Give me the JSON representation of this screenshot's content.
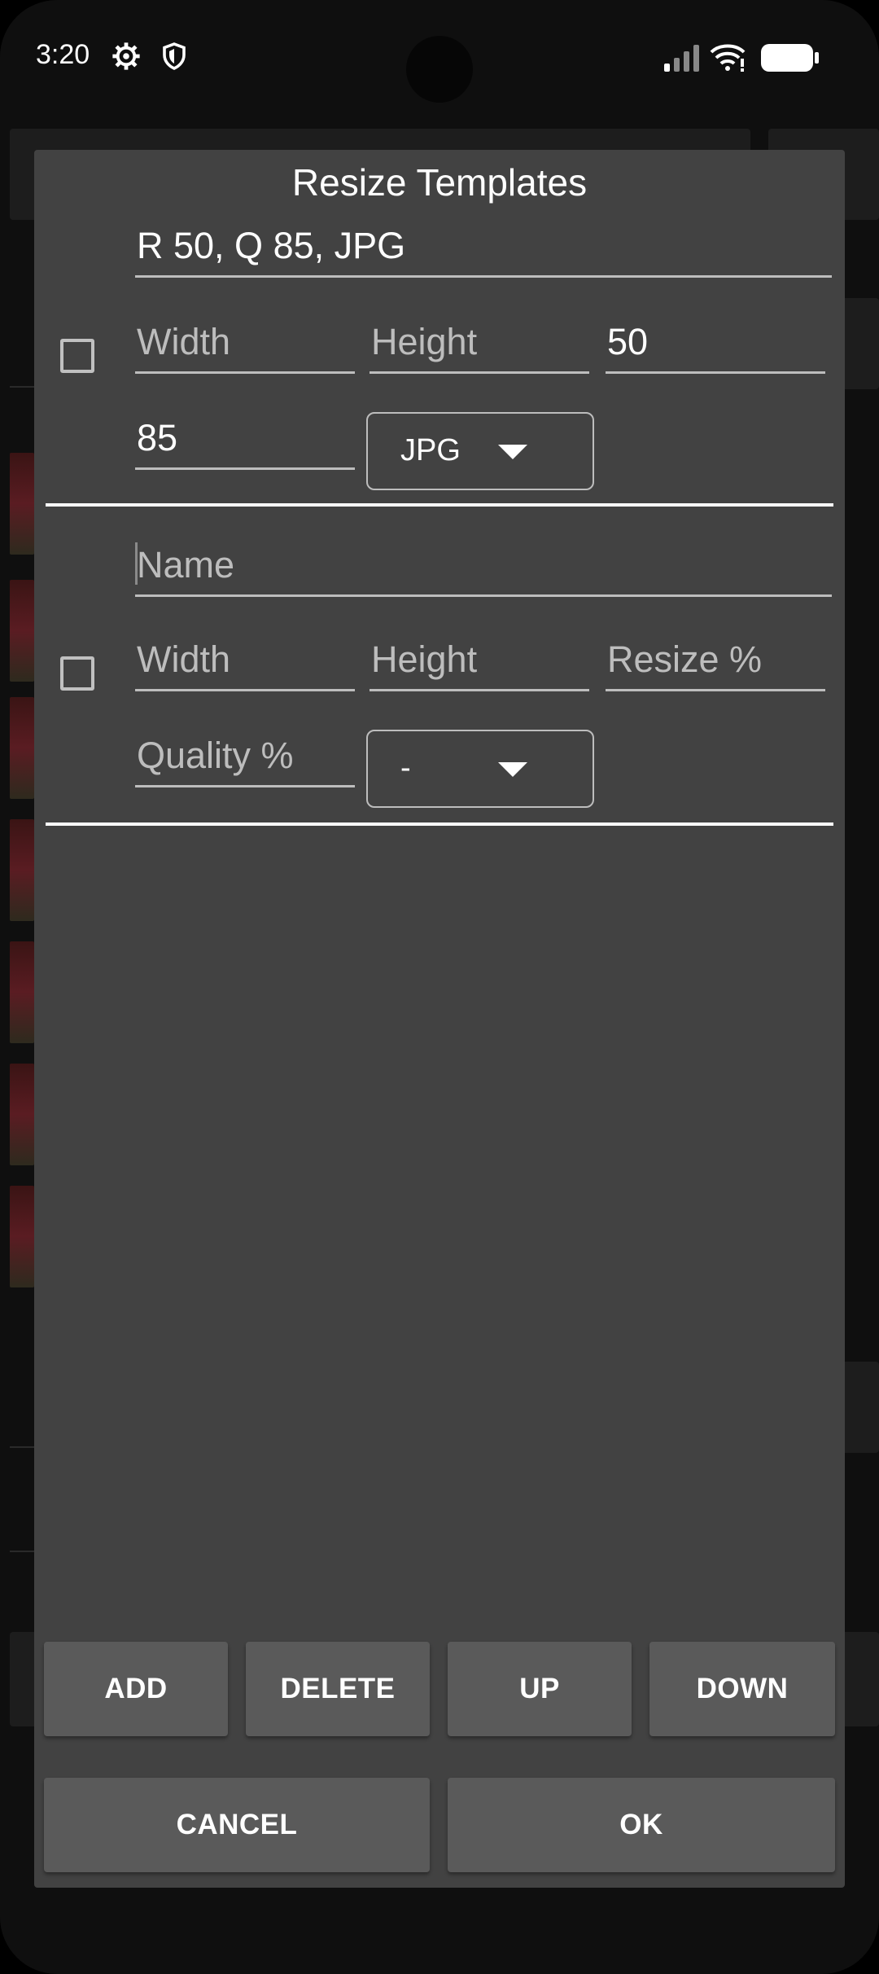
{
  "status_bar": {
    "time": "3:20",
    "icons": [
      "settings-gear-icon",
      "shield-icon",
      "signal-icon",
      "wifi-icon",
      "battery-icon"
    ]
  },
  "dialog": {
    "title": "Resize Templates",
    "templates": [
      {
        "name_value": "R 50, Q 85, JPG",
        "name_placeholder": "Name",
        "checked": false,
        "width_value": "",
        "width_placeholder": "Width",
        "height_value": "",
        "height_placeholder": "Height",
        "resize_value": "50",
        "resize_placeholder": "Resize %",
        "quality_value": "85",
        "quality_placeholder": "Quality %",
        "format_value": "JPG"
      },
      {
        "name_value": "",
        "name_placeholder": "Name",
        "checked": false,
        "width_value": "",
        "width_placeholder": "Width",
        "height_value": "",
        "height_placeholder": "Height",
        "resize_value": "",
        "resize_placeholder": "Resize %",
        "quality_value": "",
        "quality_placeholder": "Quality %",
        "format_value": "-"
      }
    ],
    "buttons": {
      "add": "ADD",
      "delete": "DELETE",
      "up": "UP",
      "down": "DOWN",
      "cancel": "CANCEL",
      "ok": "OK"
    }
  },
  "colors": {
    "dialog_bg": "#424242",
    "button_bg": "#5a5a5a",
    "text": "#ffffff",
    "hint": "#bdbdbd"
  }
}
